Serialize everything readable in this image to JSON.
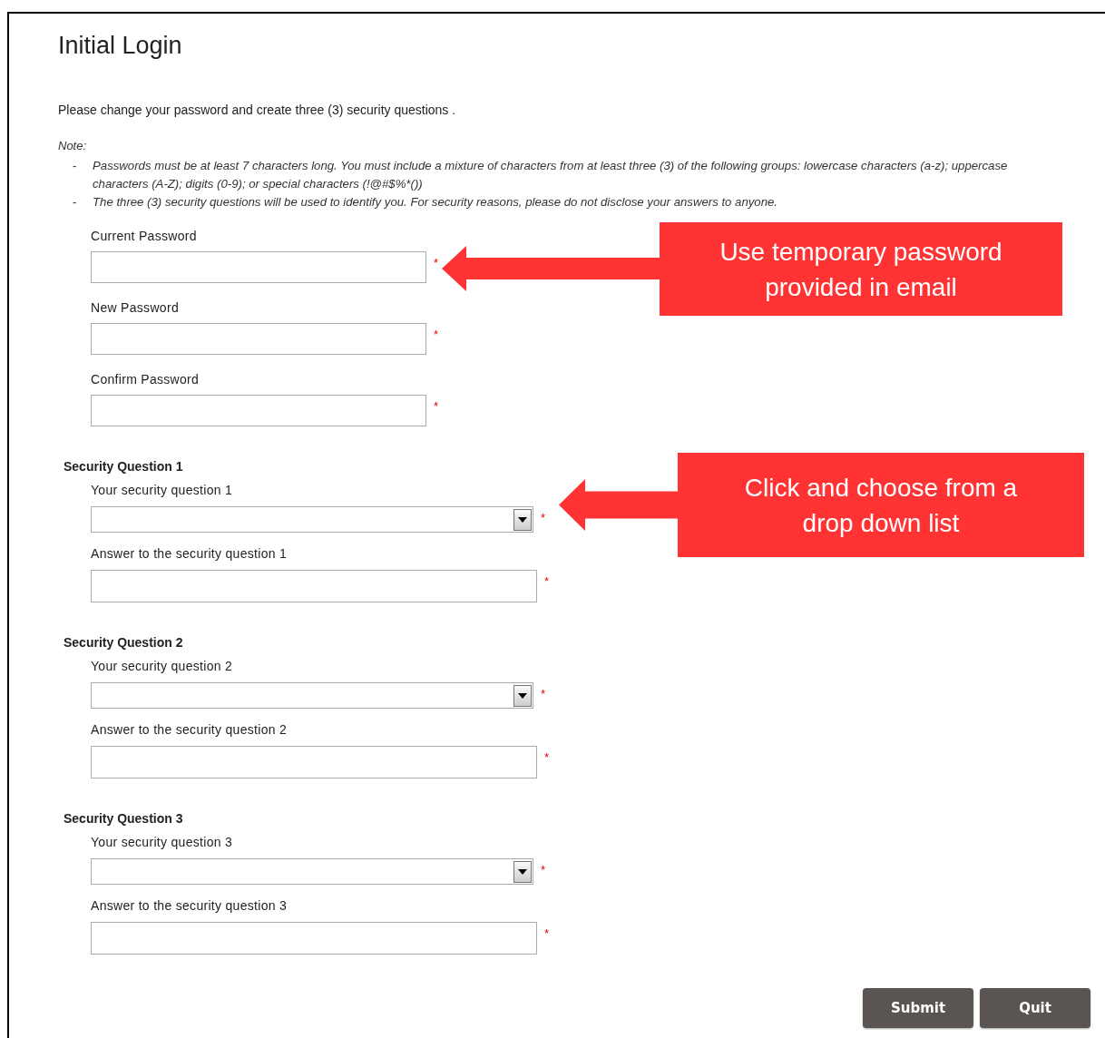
{
  "page": {
    "title": "Initial Login",
    "instructions": "Please change your password and create three (3) security questions .",
    "note_label": "Note:",
    "notes": [
      {
        "bullet": "-",
        "text": "Passwords must be at least 7 characters long. You must include a mixture of characters from at least three (3) of the following groups: lowercase characters (a-z); uppercase characters (A-Z); digits (0-9); or special characters (!@#$%*())"
      },
      {
        "bullet": "-",
        "text": "The three (3) security questions will be used to identify you. For security reasons, please do not disclose your answers to anyone."
      }
    ]
  },
  "password_fields": [
    {
      "label": "Current Password",
      "mark": "*"
    },
    {
      "label": "New Password",
      "mark": "*"
    },
    {
      "label": "Confirm Password",
      "mark": "*"
    }
  ],
  "security_questions": [
    {
      "heading": "Security Question 1",
      "question_label": "Your security question 1",
      "question_mark": "*",
      "answer_label": "Answer to the security question 1",
      "answer_mark": "*"
    },
    {
      "heading": "Security Question 2",
      "question_label": "Your security question 2",
      "question_mark": "*",
      "answer_label": "Answer to the security question 2",
      "answer_mark": "*"
    },
    {
      "heading": "Security Question 3",
      "question_label": "Your security question 3",
      "question_mark": "*",
      "answer_label": "Answer to the security question 3",
      "answer_mark": "*"
    }
  ],
  "buttons": [
    {
      "label": "Submit"
    },
    {
      "label": "Quit"
    }
  ],
  "callouts": [
    {
      "text": "Use temporary password provided in email"
    },
    {
      "text": "Click and choose from a drop down list"
    }
  ]
}
